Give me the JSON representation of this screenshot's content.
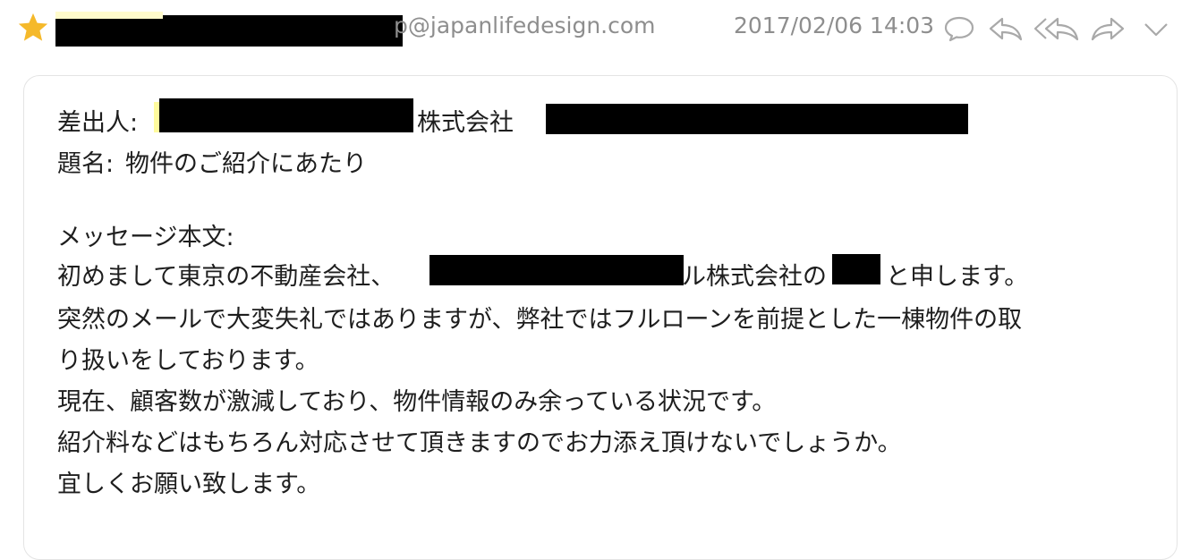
{
  "header": {
    "sender_domain": "p@japanlifedesign.com",
    "date": "2017/02/06 14:03",
    "star_color": "#f5b92a"
  },
  "actions": [
    {
      "icon": "comment-icon"
    },
    {
      "icon": "reply-icon"
    },
    {
      "icon": "reply-all-icon"
    },
    {
      "icon": "forward-icon"
    },
    {
      "icon": "chevron-down-icon"
    }
  ],
  "body": {
    "from_label": "差出人:",
    "from_company": "株式会社",
    "subject_label": "題名:",
    "subject": "物件のご紹介にあたり",
    "message_label": "メッセージ本文:",
    "line1_a": "初めまして東京の不動産会社、",
    "line1_b": "ル株式会社の",
    "line1_c": "と申します。",
    "line2": "突然のメールで大変失礼ではありますが、弊社ではフルローンを前提とした一棟物件の取",
    "line3": "り扱いをしております。",
    "line4": "現在、顧客数が激減しており、物件情報のみ余っている状況です。",
    "line5": "紹介料などはもちろん対応させて頂きますのでお力添え頂けないでしょうか。",
    "line6": "宜しくお願い致します。"
  }
}
